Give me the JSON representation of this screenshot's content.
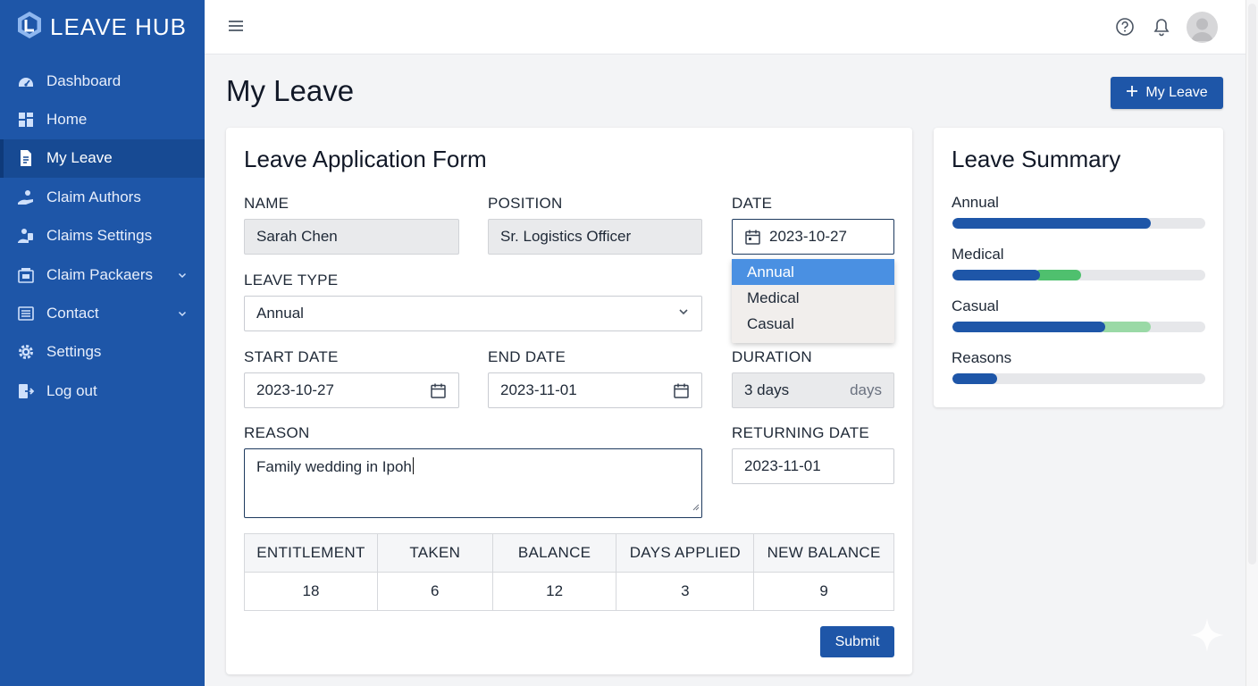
{
  "app": {
    "name": "LEAVE HUB"
  },
  "sidebar": {
    "items": [
      {
        "label": "Dashboard",
        "icon": "dashboard-icon"
      },
      {
        "label": "Home",
        "icon": "grid-icon"
      },
      {
        "label": "My Leave",
        "icon": "document-icon",
        "active": true
      },
      {
        "label": "Claim Authors",
        "icon": "user-hand-icon"
      },
      {
        "label": "Claims Settings",
        "icon": "claims-icon"
      },
      {
        "label": "Claim Packaers",
        "icon": "package-icon",
        "expandable": true
      },
      {
        "label": "Contact",
        "icon": "contact-list-icon",
        "expandable": true
      },
      {
        "label": "Settings",
        "icon": "gear-icon"
      },
      {
        "label": "Log out",
        "icon": "logout-icon"
      }
    ]
  },
  "header": {
    "page_title": "My Leave",
    "action_button": "My Leave"
  },
  "form": {
    "title": "Leave Application Form",
    "name_label": "NAME",
    "name_value": "Sarah Chen",
    "position_label": "POSITION",
    "position_value": "Sr. Logistics Officer",
    "date_label": "DATE",
    "date_value": "2023-10-27",
    "leave_type_label": "LEAVE TYPE",
    "leave_type_value": "Annual",
    "leave_type_options": [
      "Annual",
      "Medical",
      "Casual"
    ],
    "start_label": "START DATE",
    "start_value": "2023-10-27",
    "end_label": "END DATE",
    "end_value": "2023-11-01",
    "duration_label": "DURATION",
    "duration_value": "3 days",
    "duration_suffix": "days",
    "reason_label": "REASON",
    "reason_value": "Family wedding in Ipoh",
    "returning_label": "RETURNING DATE",
    "returning_value": "2023-11-01",
    "table": {
      "headers": [
        "ENTITLEMENT",
        "TAKEN",
        "BALANCE",
        "DAYS APPLIED",
        "NEW BALANCE"
      ],
      "values": [
        "18",
        "6",
        "12",
        "3",
        "9"
      ]
    },
    "submit_label": "Submit"
  },
  "summary": {
    "title": "Leave Summary",
    "items": [
      {
        "label": "Annual",
        "segments": [
          {
            "fraction": 0.785,
            "color": "#1e56a8"
          }
        ]
      },
      {
        "label": "Medical",
        "segments": [
          {
            "fraction": 0.345,
            "color": "#1e56a8"
          },
          {
            "fraction": 0.165,
            "color": "#4fc06e"
          }
        ]
      },
      {
        "label": "Casual",
        "segments": [
          {
            "fraction": 0.605,
            "color": "#1e56a8"
          },
          {
            "fraction": 0.18,
            "color": "#9ad9a6"
          }
        ]
      },
      {
        "label": "Reasons",
        "segments": [
          {
            "fraction": 0.175,
            "color": "#1e56a8"
          }
        ]
      }
    ]
  },
  "colors": {
    "brand": "#1e56a8",
    "sidebar_active": "#174a93",
    "dropdown_selected": "#4a90e2"
  }
}
